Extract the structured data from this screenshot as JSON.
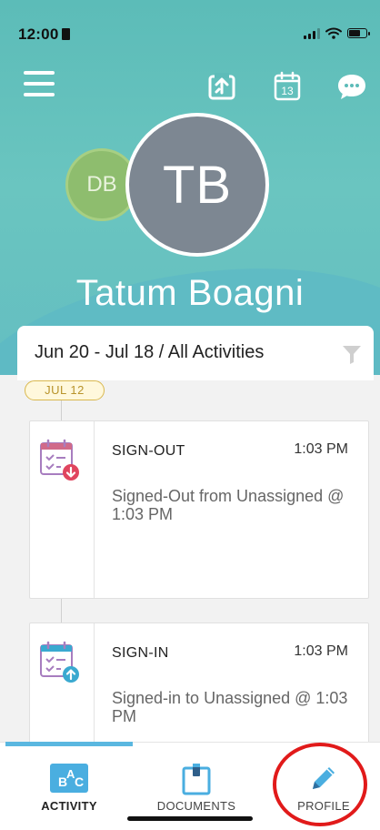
{
  "status_bar": {
    "time": "12:00"
  },
  "header": {
    "menu_icon": "hamburger-menu-icon",
    "icons": [
      "upload-icon",
      "calendar-icon",
      "chat-bubble-icon"
    ],
    "calendar_day": "13"
  },
  "profile": {
    "secondary_avatar_initials": "DB",
    "primary_avatar_initials": "TB",
    "name": "Tatum Boagni"
  },
  "filter": {
    "label": "Jun 20 - Jul 18 / All Activities",
    "icon": "filter-funnel-icon"
  },
  "feed": {
    "date_chip": "JUL 12",
    "items": [
      {
        "title": "SIGN-OUT",
        "time": "1:03 PM",
        "description": "Signed-Out from Unassigned @ 1:03 PM",
        "icon": "sign-out-calendar-icon"
      },
      {
        "title": "SIGN-IN",
        "time": "1:03 PM",
        "description": "Signed-in to Unassigned @ 1:03 PM",
        "icon": "sign-in-calendar-icon"
      }
    ]
  },
  "bottom_nav": {
    "items": [
      {
        "label": "ACTIVITY",
        "icon": "activity-abc-icon",
        "active": true
      },
      {
        "label": "DOCUMENTS",
        "icon": "documents-clipboard-icon",
        "active": false
      },
      {
        "label": "PROFILE",
        "icon": "pencil-icon",
        "active": false
      }
    ]
  },
  "colors": {
    "header_teal": "#5cbcb8",
    "accent_blue": "#5ab7e0",
    "highlight_red": "#e11a1a",
    "date_chip_gold": "#d9b84e"
  }
}
